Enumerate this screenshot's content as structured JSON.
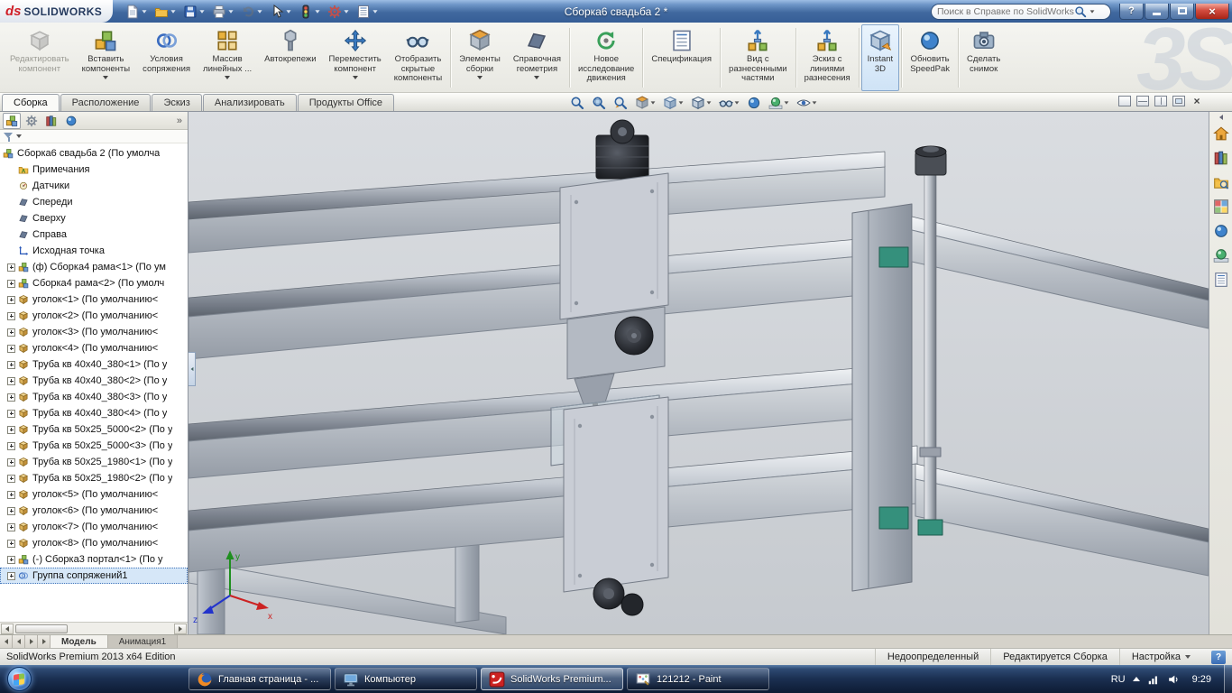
{
  "titlebar": {
    "logo_ds": "ds",
    "logo_text": "SOLIDWORKS",
    "title": "Сборка6 свадьба 2 *",
    "search_placeholder": "Поиск в Справке по SolidWorks",
    "help_glyph": "?",
    "close_glyph": "×",
    "tools": [
      {
        "name": "new-document",
        "sym": "page",
        "dropdown": true
      },
      {
        "name": "open",
        "sym": "folder",
        "dropdown": true
      },
      {
        "name": "save",
        "sym": "floppy",
        "dropdown": true
      },
      {
        "name": "print",
        "sym": "printer",
        "dropdown": true
      },
      {
        "name": "undo",
        "sym": "undo",
        "dropdown": true,
        "disabled": true
      },
      {
        "name": "select",
        "sym": "cursor",
        "dropdown": true
      },
      {
        "name": "rebuild",
        "sym": "traffic",
        "dropdown": true
      },
      {
        "name": "options",
        "sym": "gear-red",
        "dropdown": true
      },
      {
        "name": "file-properties",
        "sym": "doclines",
        "dropdown": true
      }
    ]
  },
  "ribbon": {
    "watermark": "3S",
    "buttons": [
      {
        "name": "edit-component",
        "sym": "part",
        "label": "Редактировать\nкомпонент",
        "disabled": true
      },
      {
        "name": "insert-components",
        "sym": "asm",
        "label": "Вставить\nкомпоненты",
        "dropdown": true
      },
      {
        "name": "mate",
        "sym": "mates",
        "label": "Условия\nсопряжения"
      },
      {
        "name": "linear-pattern",
        "sym": "pattern",
        "label": "Массив\nлинейных ...",
        "dropdown": true
      },
      {
        "name": "smart-fasteners",
        "sym": "bolt",
        "label": "Автокрепежи"
      },
      {
        "name": "move-component",
        "sym": "move",
        "label": "Переместить\nкомпонент",
        "dropdown": true
      },
      {
        "name": "show-hidden-components",
        "sym": "glasses",
        "label": "Отобразить\nскрытые\nкомпоненты",
        "sep": true
      },
      {
        "name": "assembly-features",
        "sym": "section",
        "label": "Элементы\nсборки",
        "dropdown": true
      },
      {
        "name": "reference-geometry",
        "sym": "plane",
        "label": "Справочная\nгеометрия",
        "dropdown": true,
        "sep": true
      },
      {
        "name": "new-motion-study",
        "sym": "motion",
        "label": "Новое\nисследование\nдвижения",
        "sep": true
      },
      {
        "name": "bill-of-materials",
        "sym": "doclines",
        "label": "Спецификация",
        "sep": true
      },
      {
        "name": "exploded-view",
        "sym": "explode",
        "label": "Вид с\nразнесенными\nчастями",
        "sep": true
      },
      {
        "name": "explode-line-sketch",
        "sym": "explode",
        "label": "Эскиз с\nлиниями\nразнесения",
        "sep": true
      },
      {
        "name": "instant-3d",
        "sym": "instant3d",
        "label": "Instant\n3D",
        "active": true,
        "sep": true
      },
      {
        "name": "update-speedpak",
        "sym": "ball",
        "label": "Обновить\nSpeedPak",
        "sep": true
      },
      {
        "name": "take-snapshot",
        "sym": "camera",
        "label": "Сделать\nснимок"
      }
    ]
  },
  "tabrow": {
    "tabs": [
      {
        "label": "Сборка",
        "active": true
      },
      {
        "label": "Расположение"
      },
      {
        "label": "Эскиз"
      },
      {
        "label": "Анализировать"
      },
      {
        "label": "Продукты Office"
      }
    ],
    "headsup": [
      {
        "name": "zoom-fit",
        "sym": "magnifier"
      },
      {
        "name": "zoom-area",
        "sym": "magnifier-rect"
      },
      {
        "name": "previous-view",
        "sym": "magnifier-prev"
      },
      {
        "name": "section-view",
        "sym": "section",
        "caret": true
      },
      {
        "name": "view-orientation",
        "sym": "cube",
        "caret": true
      },
      {
        "name": "display-style",
        "sym": "cube-shaded",
        "caret": true
      },
      {
        "name": "hide-show-items",
        "sym": "glasses",
        "caret": true
      },
      {
        "name": "edit-appearance",
        "sym": "ball"
      },
      {
        "name": "apply-scene",
        "sym": "ball-scene",
        "caret": true
      },
      {
        "name": "view-settings",
        "sym": "eye",
        "caret": true
      }
    ],
    "right_icons": [
      {
        "name": "pane-previous",
        "cls": ""
      },
      {
        "name": "pane-split-horizontal",
        "cls": "pi-split-h"
      },
      {
        "name": "pane-split-vertical",
        "cls": "pi-split-v"
      },
      {
        "name": "pane-full",
        "cls": "pi-box2"
      },
      {
        "name": "close-view",
        "cls": "pi-x",
        "glyph": "×"
      }
    ]
  },
  "panel": {
    "chevron": "»",
    "header_tabs": [
      {
        "name": "featuremanager",
        "sym": "asm",
        "active": true
      },
      {
        "name": "propertymanager",
        "sym": "gear-gray"
      },
      {
        "name": "configurationmanager",
        "sym": "books"
      },
      {
        "name": "displaymanager",
        "sym": "ball"
      }
    ],
    "tree": {
      "items": [
        {
          "label": "Сборка6 свадьба 2  (По умолча",
          "sym": "asm",
          "root": true
        },
        {
          "label": "Примечания",
          "sym": "folder-a"
        },
        {
          "label": "Датчики",
          "sym": "sensor"
        },
        {
          "label": "Спереди",
          "sym": "plane"
        },
        {
          "label": "Сверху",
          "sym": "plane"
        },
        {
          "label": "Справа",
          "sym": "plane"
        },
        {
          "label": "Исходная точка",
          "sym": "origin"
        },
        {
          "label": "(ф) Сборка4 рама<1> (По ум",
          "sym": "asm",
          "expander": true
        },
        {
          "label": "Сборка4 рама<2> (По умолч",
          "sym": "asm",
          "expander": true
        },
        {
          "label": "уголок<1> (По умолчанию<",
          "sym": "part",
          "expander": true
        },
        {
          "label": "уголок<2> (По умолчанию<",
          "sym": "part",
          "expander": true
        },
        {
          "label": "уголок<3> (По умолчанию<",
          "sym": "part",
          "expander": true
        },
        {
          "label": "уголок<4> (По умолчанию<",
          "sym": "part",
          "expander": true
        },
        {
          "label": "Труба кв 40x40_380<1> (По у",
          "sym": "part",
          "expander": true
        },
        {
          "label": "Труба кв 40x40_380<2> (По у",
          "sym": "part",
          "expander": true
        },
        {
          "label": "Труба кв 40x40_380<3> (По у",
          "sym": "part",
          "expander": true
        },
        {
          "label": "Труба кв 40x40_380<4> (По у",
          "sym": "part",
          "expander": true
        },
        {
          "label": "Труба кв 50x25_5000<2> (По у",
          "sym": "part",
          "expander": true
        },
        {
          "label": "Труба кв 50x25_5000<3> (По у",
          "sym": "part",
          "expander": true
        },
        {
          "label": "Труба кв 50x25_1980<1> (По у",
          "sym": "part",
          "expander": true
        },
        {
          "label": "Труба кв 50x25_1980<2> (По у",
          "sym": "part",
          "expander": true
        },
        {
          "label": "уголок<5> (По умолчанию<",
          "sym": "part",
          "expander": true
        },
        {
          "label": "уголок<6> (По умолчанию<",
          "sym": "part",
          "expander": true
        },
        {
          "label": "уголок<7> (По умолчанию<",
          "sym": "part",
          "expander": true
        },
        {
          "label": "уголок<8> (По умолчанию<",
          "sym": "part",
          "expander": true
        },
        {
          "label": "(-) Сборка3 портал<1> (По у",
          "sym": "asm",
          "expander": true
        },
        {
          "label": "Группа сопряжений1",
          "sym": "mates",
          "expander": true,
          "selected": true
        }
      ]
    }
  },
  "viewport": {
    "triad": {
      "x": "x",
      "y": "y",
      "z": "z"
    }
  },
  "taskpane": {
    "icons": [
      {
        "name": "solidworks-resources",
        "sym": "home"
      },
      {
        "name": "design-library",
        "sym": "books"
      },
      {
        "name": "file-explorer",
        "sym": "folder-mag"
      },
      {
        "name": "view-palette",
        "sym": "palette"
      },
      {
        "name": "appearances",
        "sym": "ball"
      },
      {
        "name": "scenes",
        "sym": "ball-scene"
      },
      {
        "name": "custom-properties",
        "sym": "doclines"
      }
    ]
  },
  "doctabs": {
    "tabs": [
      {
        "label": "Модель",
        "active": true
      },
      {
        "label": "Анимация1"
      }
    ]
  },
  "statusbar": {
    "left": "SolidWorks Premium 2013 x64 Edition",
    "items": [
      "Недоопределенный",
      "Редактируется Сборка",
      "Настройка"
    ],
    "help": "?"
  },
  "taskbar": {
    "buttons": [
      {
        "label": "Главная страница - ...",
        "sym": "firefox"
      },
      {
        "label": "Компьютер",
        "sym": "monitor"
      },
      {
        "label": "SolidWorks Premium...",
        "sym": "sw",
        "active": true
      },
      {
        "label": "121212 - Paint",
        "sym": "paint"
      }
    ],
    "tray": {
      "lang": "RU",
      "time": "9:29"
    }
  }
}
